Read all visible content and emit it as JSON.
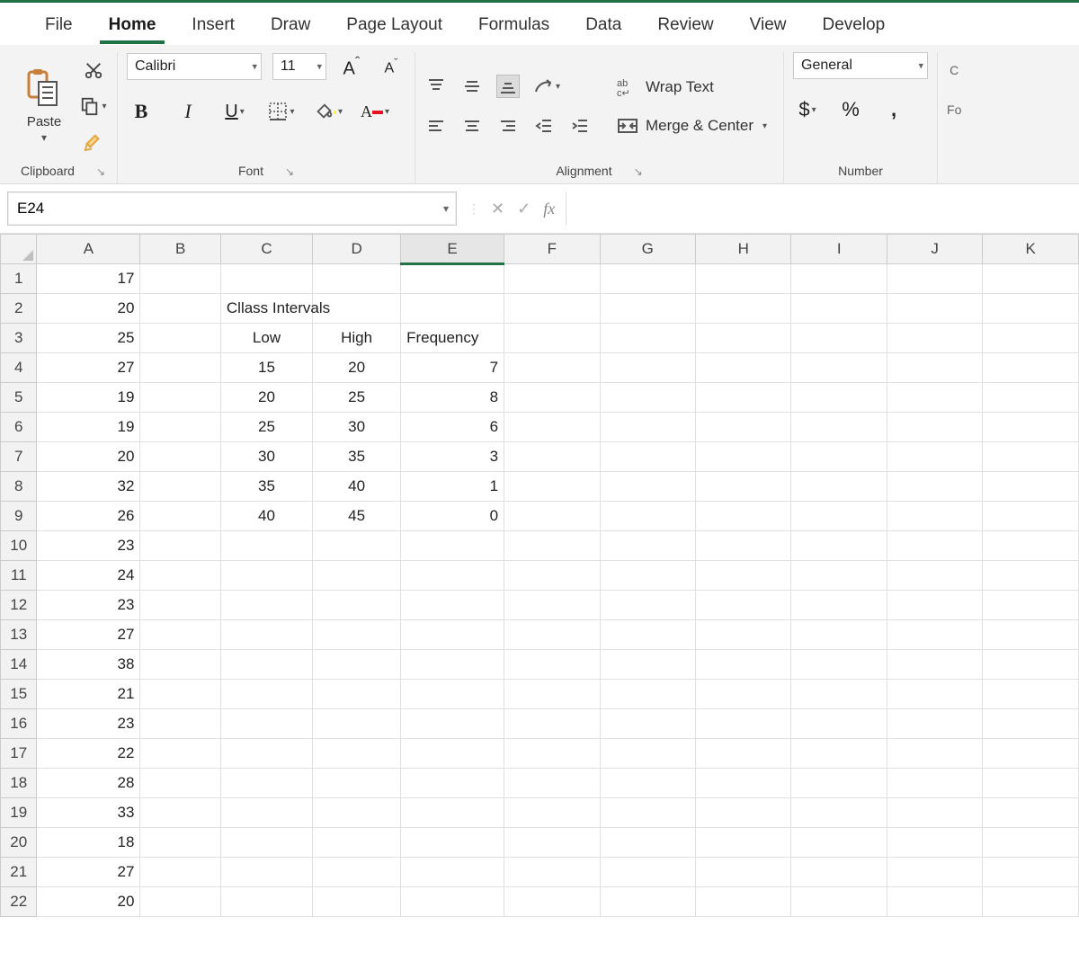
{
  "ribbon": {
    "tabs": [
      "File",
      "Home",
      "Insert",
      "Draw",
      "Page Layout",
      "Formulas",
      "Data",
      "Review",
      "View",
      "Develop"
    ],
    "active_tab": "Home",
    "groups": {
      "clipboard": {
        "label": "Clipboard",
        "paste": "Paste"
      },
      "font": {
        "label": "Font",
        "font_name": "Calibri",
        "font_size": "11",
        "bold": "B",
        "italic": "I",
        "underline": "U",
        "grow": "A",
        "shrink": "A"
      },
      "alignment": {
        "label": "Alignment",
        "wrap": "Wrap Text",
        "merge": "Merge & Center"
      },
      "number": {
        "label": "Number",
        "format": "General",
        "currency": "$",
        "percent": "%",
        "comma": ","
      },
      "format_edge": {
        "c": "C",
        "fo": "Fo"
      }
    }
  },
  "name_box": "E24",
  "fx": {
    "cancel": "✕",
    "accept": "✓",
    "fx": "fx"
  },
  "formula": "",
  "sheet": {
    "columns": [
      "A",
      "B",
      "C",
      "D",
      "E",
      "F",
      "G",
      "H",
      "I",
      "J",
      "K"
    ],
    "active_col": "E",
    "row_count": 22,
    "colA_values": {
      "1": "17",
      "2": "20",
      "3": "25",
      "4": "27",
      "5": "19",
      "6": "19",
      "7": "20",
      "8": "32",
      "9": "26",
      "10": "23",
      "11": "24",
      "12": "23",
      "13": "27",
      "14": "38",
      "15": "21",
      "16": "23",
      "17": "22",
      "18": "28",
      "19": "33",
      "20": "18",
      "21": "27",
      "22": "20"
    },
    "table_header": {
      "title": "Cllass Intervals",
      "low": "Low",
      "high": "High",
      "freq": "Frequency"
    },
    "table_rows": [
      {
        "low": "15",
        "high": "20",
        "freq": "7"
      },
      {
        "low": "20",
        "high": "25",
        "freq": "8"
      },
      {
        "low": "25",
        "high": "30",
        "freq": "6"
      },
      {
        "low": "30",
        "high": "35",
        "freq": "3"
      },
      {
        "low": "35",
        "high": "40",
        "freq": "1"
      },
      {
        "low": "40",
        "high": "45",
        "freq": "0"
      }
    ]
  }
}
